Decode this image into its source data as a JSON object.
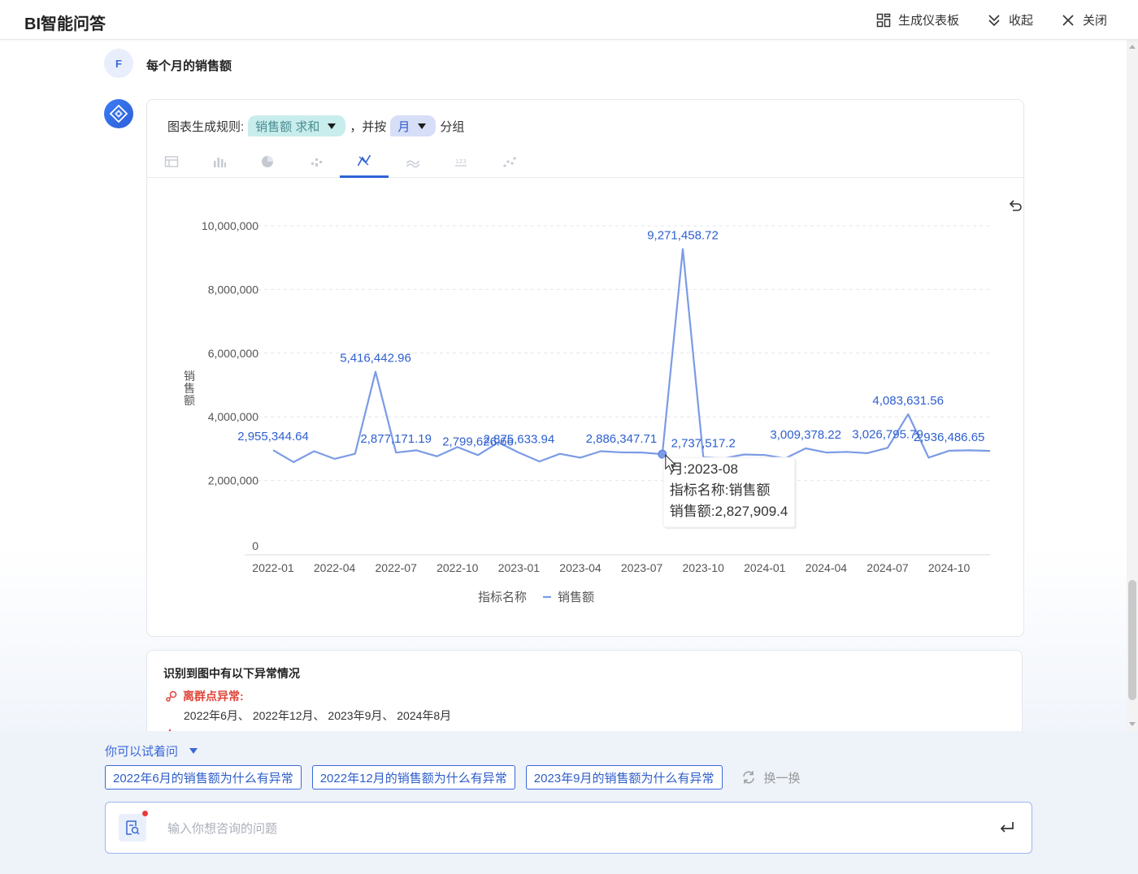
{
  "header": {
    "title": "BI智能问答",
    "actions": {
      "dashboard": "生成仪表板",
      "collapse": "收起",
      "close": "关闭"
    }
  },
  "conversation": {
    "user_avatar": "F",
    "user_question": "每个月的销售额"
  },
  "chart_panel": {
    "rule_prefix": "图表生成规则:",
    "measure_chip": "销售额 求和",
    "rule_mid": "，并按",
    "group_chip": "月",
    "rule_suffix": "分组",
    "tabs": [
      "table-icon",
      "bar-chart-icon",
      "pie-chart-icon",
      "scatter-icon",
      "line-chart-icon",
      "area-chart-icon",
      "number-card-icon",
      "dots-icon"
    ],
    "active_tab": 4
  },
  "chart_data": {
    "type": "line",
    "ylabel": "销售额",
    "ylim": [
      0,
      10000000
    ],
    "yticks": [
      0,
      2000000,
      4000000,
      6000000,
      8000000,
      10000000
    ],
    "ytick_labels": [
      "0",
      "2,000,000",
      "4,000,000",
      "6,000,000",
      "8,000,000",
      "10,000,000"
    ],
    "x": [
      "2022-01",
      "2022-02",
      "2022-03",
      "2022-04",
      "2022-05",
      "2022-06",
      "2022-07",
      "2022-08",
      "2022-09",
      "2022-10",
      "2022-11",
      "2022-12",
      "2023-01",
      "2023-02",
      "2023-03",
      "2023-04",
      "2023-05",
      "2023-06",
      "2023-07",
      "2023-08",
      "2023-09",
      "2023-10",
      "2023-11",
      "2023-12",
      "2024-01",
      "2024-02",
      "2024-03",
      "2024-04",
      "2024-05",
      "2024-06",
      "2024-07",
      "2024-08",
      "2024-09",
      "2024-10",
      "2024-11",
      "2024-12"
    ],
    "xtick_labels": [
      "2022-01",
      "2022-04",
      "2022-07",
      "2022-10",
      "2023-01",
      "2023-04",
      "2023-07",
      "2023-10",
      "2024-01",
      "2024-04",
      "2024-07",
      "2024-10"
    ],
    "series": [
      {
        "name": "销售额",
        "color": "#7b9be6",
        "values": [
          2955344.64,
          2580000,
          2920000,
          2680000,
          2840000,
          5416442.96,
          2877171.19,
          2950000,
          2760000,
          3050000,
          2799626.66,
          3200000,
          2875633.94,
          2600000,
          2840000,
          2720000,
          2920000,
          2886347.71,
          2880000,
          2827909.4,
          9271458.72,
          2737517.2,
          2700000,
          2820000,
          2800000,
          2700000,
          3009378.22,
          2880000,
          2900000,
          2860000,
          3026795.79,
          4083631.56,
          2720000,
          2936486.65,
          2950000,
          2930000
        ]
      }
    ],
    "data_labels": [
      {
        "i": 0,
        "text": "2,955,344.64"
      },
      {
        "i": 5,
        "text": "5,416,442.96"
      },
      {
        "i": 6,
        "text": "2,877,171.19"
      },
      {
        "i": 10,
        "text": "2,799,626.66"
      },
      {
        "i": 12,
        "text": "2,875,633.94"
      },
      {
        "i": 17,
        "text": "2,886,347.71"
      },
      {
        "i": 20,
        "text": "9,271,458.72"
      },
      {
        "i": 21,
        "text": "2,737,517.2"
      },
      {
        "i": 26,
        "text": "3,009,378.22"
      },
      {
        "i": 30,
        "text": "3,026,795.79"
      },
      {
        "i": 31,
        "text": "4,083,631.56"
      },
      {
        "i": 33,
        "text": "2,936,486.65"
      }
    ],
    "legend_title": "指标名称",
    "legend_position": "bottom-center",
    "grid": true,
    "tooltip": {
      "index": 19,
      "lines": [
        "月:2023-08",
        "指标名称:销售额",
        "销售额:2,827,909.4"
      ]
    }
  },
  "anomaly": {
    "title": "识别到图中有以下异常情况",
    "type_label": "离群点异常:",
    "items": "2022年6月、 2022年12月、 2023年9月、 2024年8月"
  },
  "suggestions": {
    "toggle_label": "你可以试着问",
    "items": [
      "2022年6月的销售额为什么有异常",
      "2022年12月的销售额为什么有异常",
      "2023年9月的销售额为什么有异常"
    ],
    "refresh_label": "换一换"
  },
  "input": {
    "placeholder": "输入你想咨询的问题"
  }
}
